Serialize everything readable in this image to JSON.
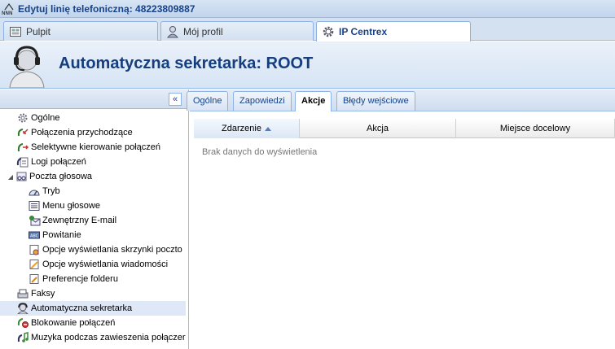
{
  "window": {
    "title": "Edytuj linię telefoniczną: 48223809887"
  },
  "top_tabs": [
    {
      "label": "Pulpit",
      "icon": "dashboard-icon"
    },
    {
      "label": "Mój profil",
      "icon": "user-icon"
    },
    {
      "label": "IP Centrex",
      "icon": "gear-icon",
      "active": true
    }
  ],
  "header": {
    "title": "Automatyczna sekretarka: ROOT"
  },
  "sidebar": {
    "collapse_label": "«",
    "items": [
      {
        "label": "Ogólne"
      },
      {
        "label": "Połączenia przychodzące"
      },
      {
        "label": "Selektywne kierowanie połączeń"
      },
      {
        "label": "Logi połączeń"
      },
      {
        "label": "Poczta głosowa",
        "expanded": true
      },
      {
        "label": "Tryb"
      },
      {
        "label": "Menu głosowe"
      },
      {
        "label": "Zewnętrzny E-mail"
      },
      {
        "label": "Powitanie"
      },
      {
        "label": "Opcje wyświetlania skrzynki poczto"
      },
      {
        "label": "Opcje wyświetlania wiadomości"
      },
      {
        "label": "Preferencje folderu"
      },
      {
        "label": "Faksy"
      },
      {
        "label": "Automatyczna sekretarka",
        "selected": true
      },
      {
        "label": "Blokowanie połączeń"
      },
      {
        "label": "Muzyka podczas zawieszenia połączer"
      }
    ]
  },
  "content_tabs": [
    {
      "label": "Ogólne"
    },
    {
      "label": "Zapowiedzi"
    },
    {
      "label": "Akcje",
      "active": true
    },
    {
      "label": "Błędy wejściowe"
    }
  ],
  "grid": {
    "columns": [
      "Zdarzenie",
      "Akcja",
      "Miejsce docelowy"
    ],
    "sorted_column": "Zdarzenie",
    "empty_text": "Brak danych do wyświetlenia"
  },
  "colors": {
    "accent": "#15428b",
    "border": "#99bbe8",
    "selected": "#dfe8f6"
  }
}
